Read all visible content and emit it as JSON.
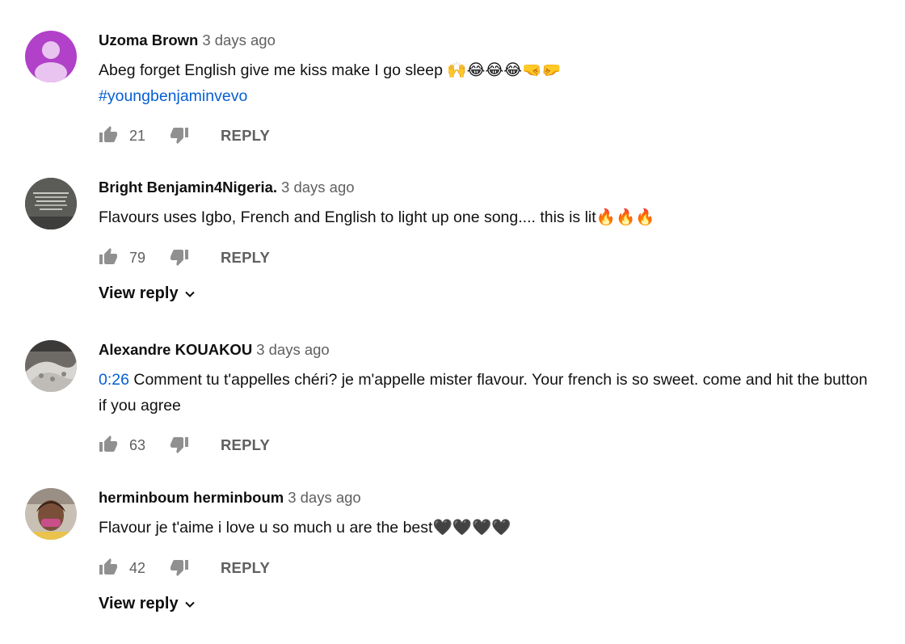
{
  "comments": [
    {
      "author": "Uzoma Brown",
      "time": "3 days ago",
      "text": "Abeg forget English  give me kiss make I go sleep ",
      "emojis": "🙌😂😂😂🤜🤛",
      "hashtag": "#youngbenjaminvevo",
      "likes": "21",
      "reply_label": "REPLY",
      "avatar_color": "#b041c8"
    },
    {
      "author": "Bright Benjamin4Nigeria.",
      "time": "3 days ago",
      "text": "Flavours uses Igbo, French and English to light up one song.... this is lit",
      "emojis": "🔥🔥🔥",
      "likes": "79",
      "reply_label": "REPLY",
      "view_reply": "View reply"
    },
    {
      "author": "Alexandre KOUAKOU",
      "time": "3 days ago",
      "timestamp_link": "0:26",
      "text": " Comment tu t'appelles chéri? je m'appelle mister flavour. Your french is so sweet. come and hit the button if you agree",
      "likes": "63",
      "reply_label": "REPLY"
    },
    {
      "author": "herminboum herminboum",
      "time": "3 days ago",
      "text": "Flavour je t'aime i love u so much u are the best",
      "emojis": "🖤🖤🖤🖤",
      "likes": "42",
      "reply_label": "REPLY",
      "view_reply": "View reply"
    }
  ],
  "icons": {
    "like": "thumb-up-icon",
    "dislike": "thumb-down-icon",
    "expand": "chevron-down-icon"
  },
  "colors": {
    "link": "#065fd4",
    "secondary_text": "#606060",
    "icon": "#909090"
  }
}
